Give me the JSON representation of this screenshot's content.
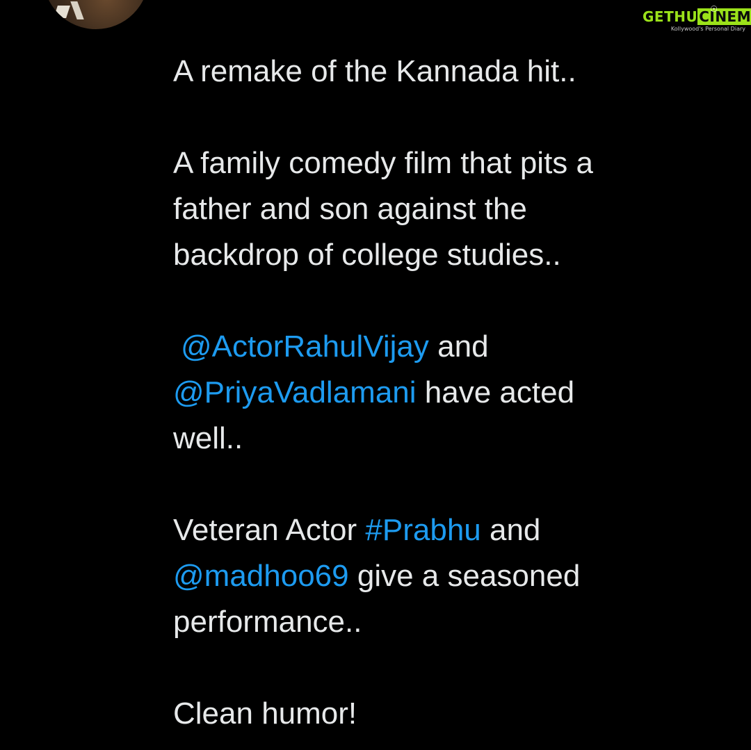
{
  "avatar": {
    "icon": "profile-photo"
  },
  "watermark": {
    "brand_part1": "GETHU",
    "brand_part2": "CINEMA",
    "tagline": "Kollywood's Personal Diary",
    "color": "#9be21a"
  },
  "tweet": {
    "para1": "A remake of the Kannada hit..",
    "para2_line1": "A family comedy film that pits a",
    "para2_line2": "father and son against the",
    "para2_line3": "backdrop of college studies..",
    "para3_mention1": "@ActorRahulVijay",
    "para3_text1": " and",
    "para3_mention2": "@PriyaVadlamani",
    "para3_text2": " have acted",
    "para3_line3": "well..",
    "para4_text1": "Veteran Actor ",
    "para4_hashtag": "#Prabhu",
    "para4_text2": " and",
    "para4_mention": "@madhoo69",
    "para4_text3": " give a seasoned",
    "para4_line3": "performance..",
    "para5": "Clean humor!"
  },
  "colors": {
    "background": "#000000",
    "text": "#e7e9ea",
    "link": "#1d9bf0"
  }
}
